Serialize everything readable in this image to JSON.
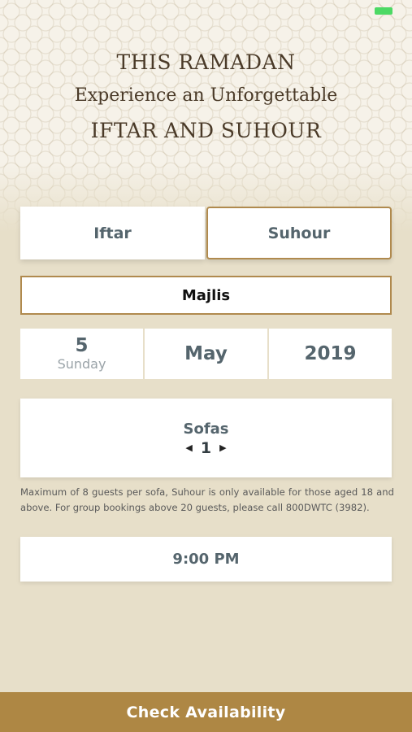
{
  "status_bar": {
    "battery_icon": "battery-icon",
    "battery_color": "#4cd964"
  },
  "header": {
    "line1": "THIS RAMADAN",
    "line2": "Experience an Unforgettable",
    "line3": "IFTAR AND SUHOUR"
  },
  "tabs": [
    {
      "label": "Iftar",
      "selected": false
    },
    {
      "label": "Suhour",
      "selected": true
    }
  ],
  "venue": {
    "label": "Majlis"
  },
  "date": {
    "day": "5",
    "weekday": "Sunday",
    "month": "May",
    "year": "2019"
  },
  "sofas": {
    "label": "Sofas",
    "count": "1",
    "decrement_icon": "caret-left-icon",
    "increment_icon": "caret-right-icon"
  },
  "note": "Maximum of 8 guests per sofa, Suhour is only available for those aged 18 and above. For group bookings above 20 guests, please call 800DWTC (3982).",
  "time": {
    "value": "9:00 PM"
  },
  "cta": {
    "label": "Check Availability"
  },
  "colors": {
    "accent": "#ae8744",
    "border": "#b08a4e",
    "background": "#e7dfc9",
    "text": "#55656d"
  }
}
